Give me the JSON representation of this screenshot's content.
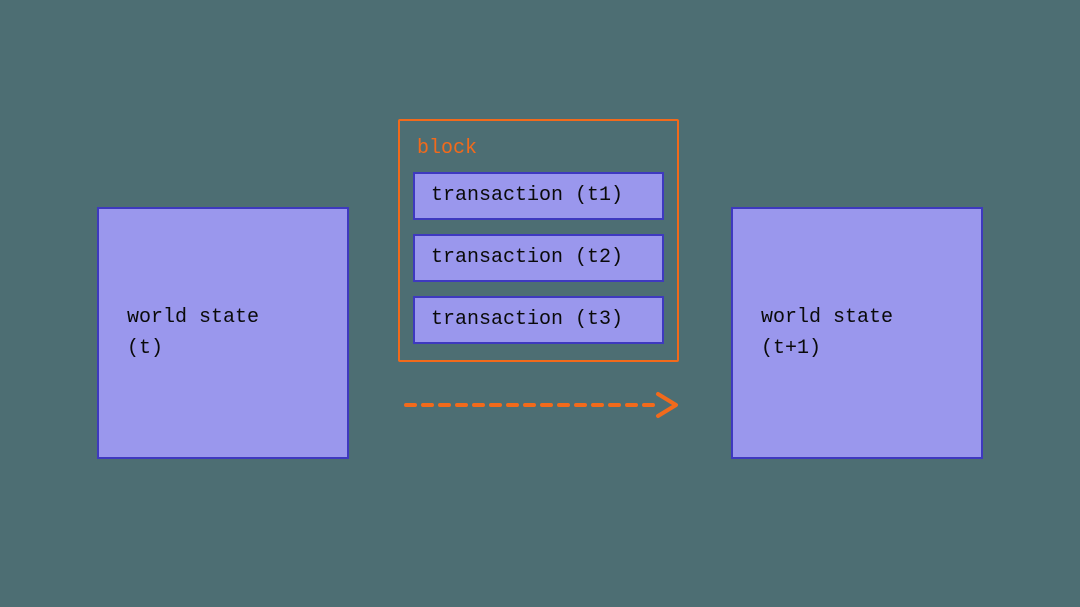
{
  "left_state": {
    "line1": "world state",
    "line2": "(t)"
  },
  "right_state": {
    "line1": "world state",
    "line2": "(t+1)"
  },
  "block": {
    "title": "block",
    "transactions": [
      "transaction (t1)",
      "transaction (t2)",
      "transaction (t3)"
    ]
  },
  "colors": {
    "background": "#4D6E73",
    "box_fill": "#9A97ED",
    "box_border": "#3E39BF",
    "accent": "#F26A1B"
  }
}
